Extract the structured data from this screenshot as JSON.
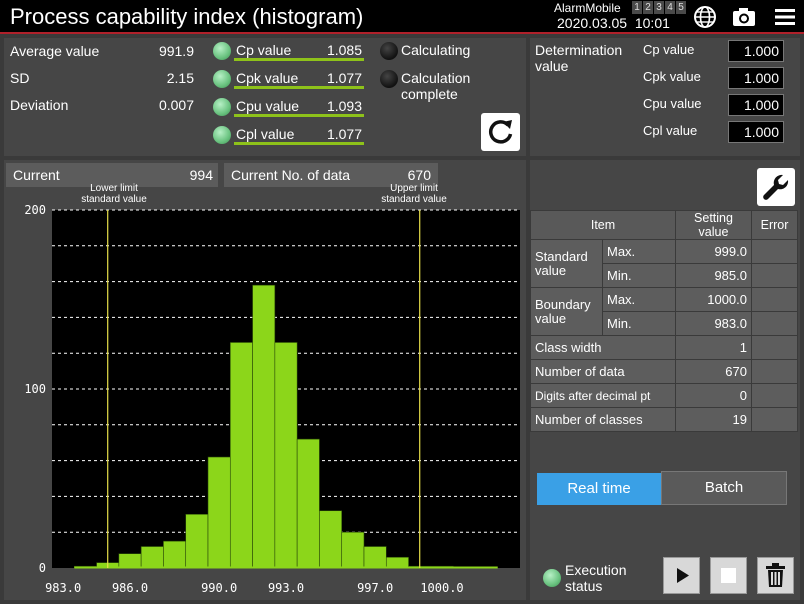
{
  "title": "Process capability index (histogram)",
  "header": {
    "alarm_label": "AlarmMobile",
    "alarm_slots": [
      "1",
      "2",
      "3",
      "4",
      "5"
    ],
    "date": "2020.03.05",
    "time": "10:01"
  },
  "stats": {
    "average_label": "Average value",
    "average_value": "991.9",
    "sd_label": "SD",
    "sd_value": "2.15",
    "deviation_label": "Deviation",
    "deviation_value": "0.007"
  },
  "capability": [
    {
      "label": "Cp value",
      "value": "1.085"
    },
    {
      "label": "Cpk value",
      "value": "1.077"
    },
    {
      "label": "Cpu value",
      "value": "1.093"
    },
    {
      "label": "Cpl value",
      "value": "1.077"
    }
  ],
  "status": {
    "calculating": "Calculating",
    "complete_line1": "Calculation",
    "complete_line2": "complete"
  },
  "determination": {
    "title_line1": "Determination",
    "title_line2": "value",
    "items": [
      {
        "label": "Cp value",
        "value": "1.000"
      },
      {
        "label": "Cpk value",
        "value": "1.000"
      },
      {
        "label": "Cpu value",
        "value": "1.000"
      },
      {
        "label": "Cpl value",
        "value": "1.000"
      }
    ]
  },
  "current": {
    "label": "Current",
    "value": "994",
    "count_label": "Current No. of data",
    "count_value": "670"
  },
  "limits": {
    "lower_line1": "Lower limit",
    "lower_line2": "standard value",
    "upper_line1": "Upper limit",
    "upper_line2": "standard value"
  },
  "chart_data": {
    "type": "bar",
    "x": [
      984,
      985,
      986,
      987,
      988,
      989,
      990,
      991,
      992,
      993,
      994,
      995,
      996,
      997,
      998,
      999,
      1000,
      1001,
      1002
    ],
    "values": [
      1,
      3,
      8,
      12,
      15,
      30,
      62,
      126,
      158,
      126,
      72,
      32,
      20,
      12,
      6,
      1,
      1,
      0,
      0
    ],
    "bin_width": 1,
    "xlim": [
      982.5,
      1003.5
    ],
    "ylim": [
      0,
      200
    ],
    "yticks": [
      "0",
      "100",
      "200"
    ],
    "xticks": [
      "983.0",
      "986.0",
      "990.0",
      "993.0",
      "997.0",
      "1000.0"
    ],
    "xtick_values": [
      983,
      986,
      990,
      993,
      997,
      1000
    ],
    "lower_limit": 985,
    "upper_limit": 999,
    "grid": true,
    "bar_color": "#8cd61a",
    "limit_line_color": "#e8e04a"
  },
  "settings": {
    "head_item": "Item",
    "head_setting": "Setting value",
    "head_error": "Error",
    "standard_line1": "Standard",
    "standard_line2": "value",
    "boundary_line1": "Boundary",
    "boundary_line2": "value",
    "max_label": "Max.",
    "min_label": "Min.",
    "standard_max": "999.0",
    "standard_min": "985.0",
    "boundary_max": "1000.0",
    "boundary_min": "983.0",
    "class_width_label": "Class width",
    "class_width": "1",
    "num_data_label": "Number of data",
    "num_data": "670",
    "digits_label": "Digits after decimal pt",
    "digits": "0",
    "num_classes_label": "Number of classes",
    "num_classes": "19"
  },
  "mode_tabs": {
    "realtime": "Real time",
    "batch": "Batch"
  },
  "execution": {
    "line1": "Execution",
    "line2": "status"
  },
  "colors": {
    "accent_blue": "#3aa0e6",
    "capability_green": "#8ec21a",
    "titlebar_red": "#b0202a"
  },
  "icons": [
    "globe-icon",
    "camera-icon",
    "menu-icon",
    "refresh-icon",
    "wrench-icon",
    "play-icon",
    "stop-icon",
    "trash-icon"
  ]
}
